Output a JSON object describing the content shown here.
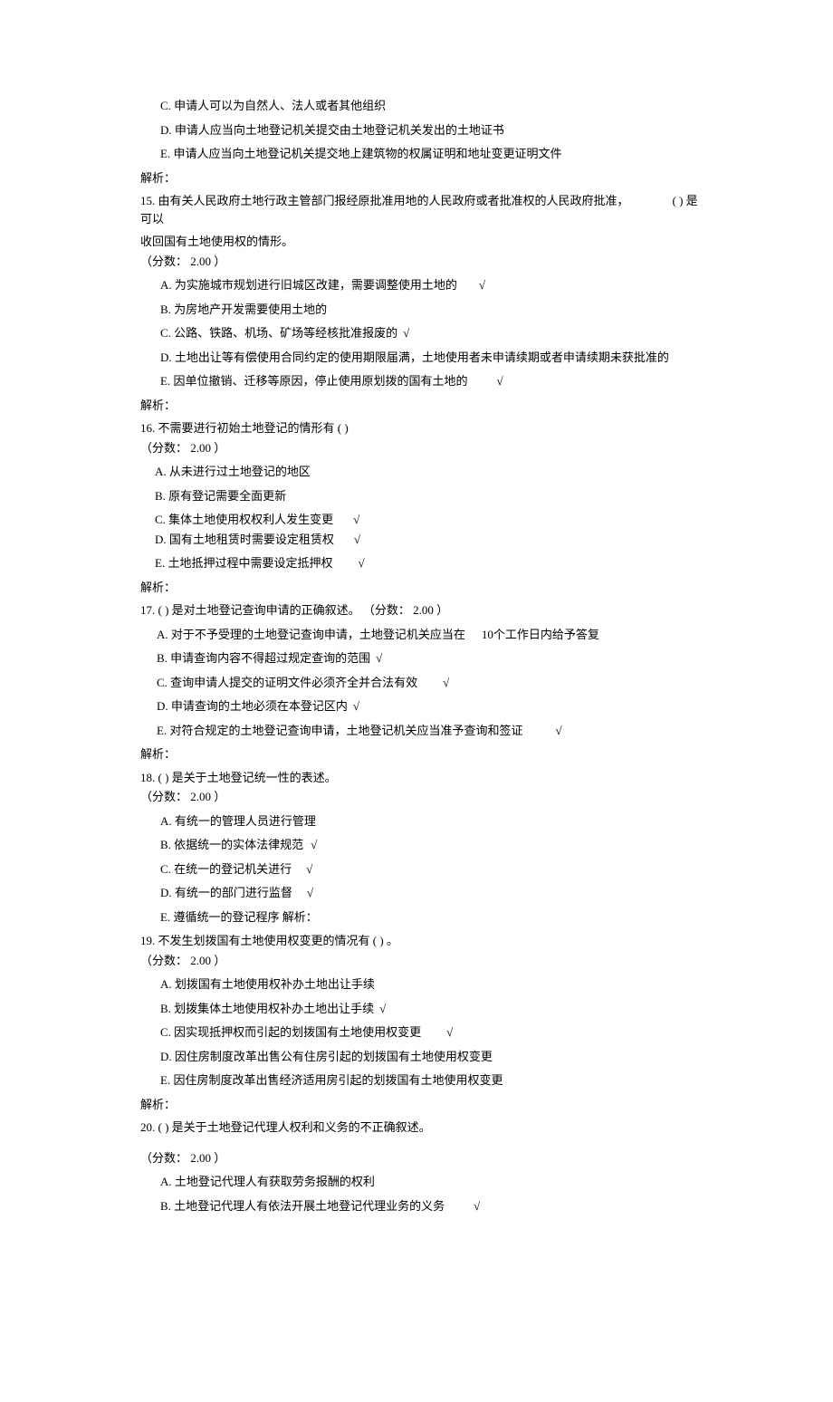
{
  "mark": "√",
  "analysis_label": "解析：",
  "q14_partial": {
    "C": "C.  申请人可以为自然人、法人或者其他组织",
    "D": "D.  申请人应当向土地登记机关提交由土地登记机关发出的土地证书",
    "E": "E.  申请人应当向土地登记机关提交地上建筑物的权属证明和地址变更证明文件"
  },
  "q15": {
    "stem1": "15.   由有关人民政府土地行政主管部门报经原批准用地的人民政府或者批准权的人民政府批准，",
    "stem_paren": "(  ) 是可以",
    "stem2": "收回国有土地使用权的情形。",
    "score": "（分数：  2.00 ）",
    "A": "A.  为实施城市规划进行旧城区改建，需要调整使用土地的",
    "B": "B.  为房地产开发需要使用土地的",
    "C": "C.  公路、铁路、机场、矿场等经核批准报废的",
    "D": "D.  土地出让等有偿使用合同约定的使用期限届满，土地使用者未申请续期或者申请续期未获批准的",
    "E": "E.  因单位撤销、迁移等原因，停止使用原划拨的国有土地的"
  },
  "q16": {
    "stem": "16. 不需要进行初始土地登记的情形有 (  )",
    "score": "（分数：  2.00 ）",
    "A": "A. 从未进行过土地登记的地区",
    "B": "B. 原有登记需要全面更新",
    "C": "C. 集体土地使用权权利人发生变更",
    "D": "D. 国有土地租赁时需要设定租赁权",
    "E": "E. 土地抵押过程中需要设定抵押权"
  },
  "q17": {
    "stem": "17.  (  ) 是对土地登记查询申请的正确叙述。  （分数：  2.00 ）",
    "A": "A.  对于不予受理的土地登记查询申请，土地登记机关应当在",
    "A_tail": "10个工作日内给予答复",
    "B": "B.  申请查询内容不得超过规定查询的范围",
    "C": "C.  查询申请人提交的证明文件必须齐全并合法有效",
    "D": "D.  申请查询的土地必须在本登记区内",
    "E": "E.  对符合规定的土地登记查询申请，土地登记机关应当准予查询和签证"
  },
  "q18": {
    "stem": "18.  (  ) 是关于土地登记统一性的表述。",
    "score": "（分数：  2.00 ）",
    "A": "A.  有统一的管理人员进行管理",
    "B": "B.  依据统一的实体法律规范",
    "C": "C.  在统一的登记机关进行",
    "D": "D.  有统一的部门进行监督",
    "E": "E.  遵循统一的登记程序  解析："
  },
  "q19": {
    "stem": "19.   不发生划拨国有土地使用权变更的情况有 (  ) 。",
    "score": "（分数：  2.00 ）",
    "A": "A.  划拨国有土地使用权补办土地出让手续",
    "B": "B.  划拨集体土地使用权补办土地出让手续",
    "C": "C.  因实现抵押权而引起的划拨国有土地使用权变更",
    "D": "D.  因住房制度改革出售公有住房引起的划拨国有土地使用权变更",
    "E": "E.  因住房制度改革出售经济适用房引起的划拨国有土地使用权变更"
  },
  "q20": {
    "stem": "20.  (  ) 是关于土地登记代理人权利和义务的不正确叙述。",
    "score": "（分数：  2.00 ）",
    "A": "A.  土地登记代理人有获取劳务报酬的权利",
    "B": "B.  土地登记代理人有依法开展土地登记代理业务的义务"
  }
}
